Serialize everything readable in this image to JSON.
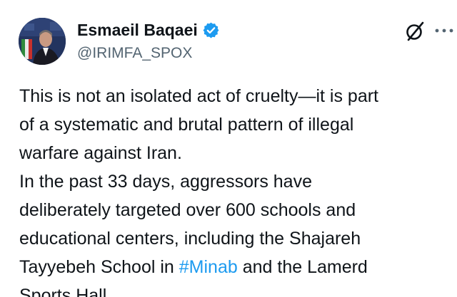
{
  "author": {
    "display_name": "Esmaeil Baqaei",
    "handle": "@IRIMFA_SPOX",
    "verified": true,
    "verified_color": "#1d9bf0",
    "avatar_icon": "profile-photo"
  },
  "actions": {
    "grok_icon": "grok-slash-icon",
    "more_icon": "more-horizontal-icon"
  },
  "tweet": {
    "lines": [
      "This is not an isolated act of cruelty—it is part",
      "of a systematic and brutal pattern of illegal",
      "warfare against Iran.",
      "In the past 33 days, aggressors have",
      "deliberately targeted over 600 schools and",
      "educational centers, including the Shajareh"
    ],
    "line7_before": "Tayyebeh School in ",
    "line7_hashtag": "#Minab",
    "line7_after": " and the Lamerd",
    "line8": "Sports Hall."
  },
  "colors": {
    "text": "#0f1419",
    "secondary": "#536471",
    "link": "#1d9bf0"
  }
}
